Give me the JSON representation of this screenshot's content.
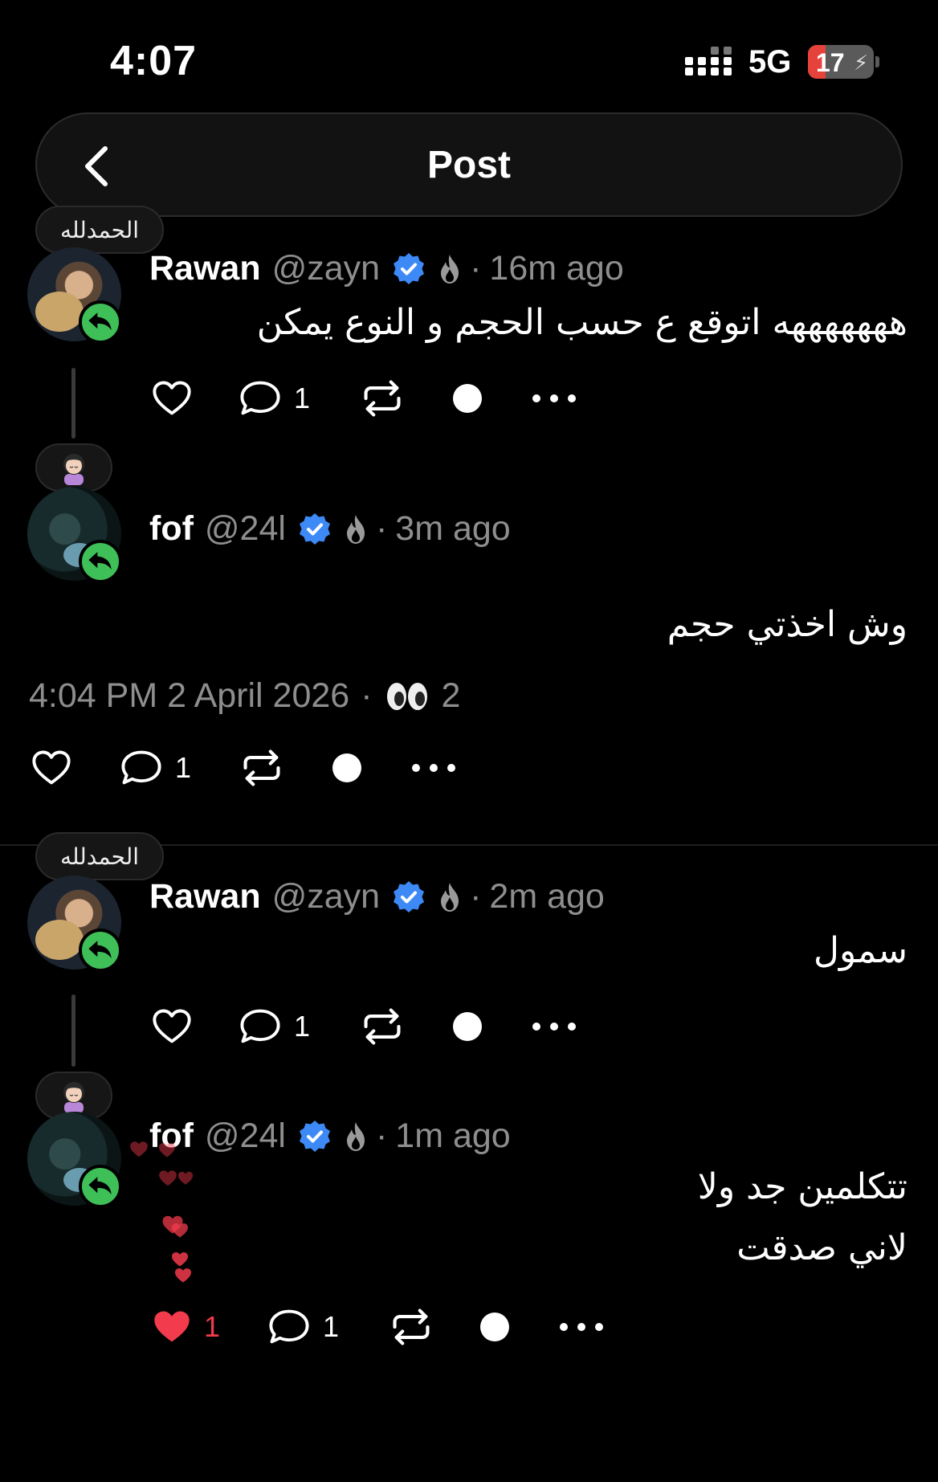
{
  "status_bar": {
    "time": "4:07",
    "network": "5G",
    "battery_level": "17",
    "battery_fraction": 0.17
  },
  "nav": {
    "title": "Post"
  },
  "posts": [
    {
      "note": "الحمدلله",
      "name": "Rawan",
      "handle": "@zayn",
      "separator": "·",
      "time": "16m ago",
      "text": "هههههههه اتوقع ع حسب الحجم و النوع يمكن",
      "reply_count": "1"
    },
    {
      "name": "fof",
      "handle": "@24l",
      "separator": "·",
      "time": "3m ago",
      "text": "وش اخذتي حجم",
      "meta_time": "4:04 PM 2 April 2026",
      "meta_sep": "·",
      "views": "2",
      "reply_count": "1"
    },
    {
      "note": "الحمدلله",
      "name": "Rawan",
      "handle": "@zayn",
      "separator": "·",
      "time": "2m ago",
      "text": "سمول",
      "reply_count": "1"
    },
    {
      "name": "fof",
      "handle": "@24l",
      "separator": "·",
      "time": "1m ago",
      "text_line1": "تتكلمين جد ولا",
      "text_line2": "لاني صدقت",
      "like_count": "1",
      "reply_count": "1"
    }
  ],
  "colors": {
    "verified": "#3d8af7",
    "liked": "#f23b4c",
    "reply_badge": "#3fbf58",
    "muted": "#8e8e8e"
  },
  "icons": [
    "back-chevron-icon",
    "heart-icon",
    "comment-icon",
    "repost-icon",
    "dot-icon",
    "more-icon",
    "verified-badge-icon",
    "flame-icon",
    "eyes-icon",
    "reply-arrow-icon"
  ]
}
